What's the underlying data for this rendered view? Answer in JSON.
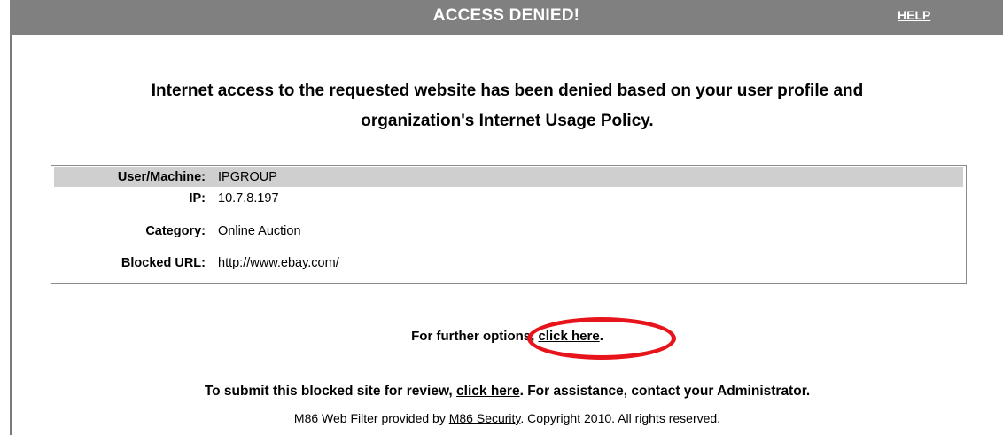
{
  "header": {
    "title": "ACCESS DENIED!",
    "help_label": "HELP"
  },
  "message": {
    "line1": "Internet access to the requested website has been denied based on your user profile and",
    "line2": "organization's Internet Usage Policy."
  },
  "info": {
    "rows": [
      {
        "label": "User/Machine:",
        "value": "IPGROUP"
      },
      {
        "label": "IP:",
        "value": "10.7.8.197"
      },
      {
        "label": "Category:",
        "value": "Online Auction"
      },
      {
        "label": "Blocked URL:",
        "value": "http://www.ebay.com/"
      }
    ]
  },
  "options": {
    "prefix": "For further options, ",
    "link": "click here",
    "suffix": "."
  },
  "submit": {
    "prefix": "To submit this blocked site for review, ",
    "link": "click here",
    "suffix": ". For assistance, contact your Administrator."
  },
  "footer": {
    "prefix": "M86 Web Filter provided by ",
    "link": "M86 Security",
    "suffix": ". Copyright 2010. All rights reserved."
  },
  "colors": {
    "header_bg": "#808080",
    "highlight_row": "#cfcfcf",
    "annotation_circle": "#e8141b"
  }
}
